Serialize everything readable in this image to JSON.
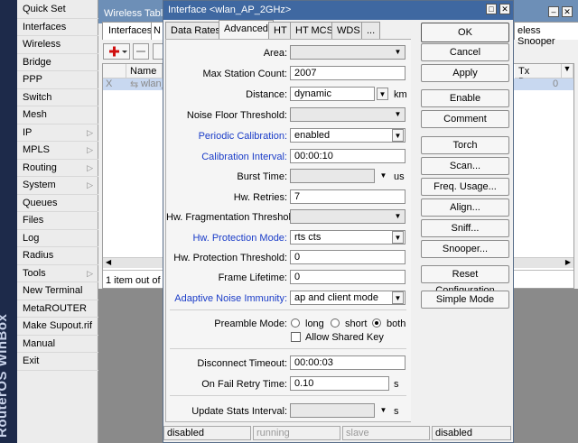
{
  "brand": {
    "text": "RouterOS WinBox"
  },
  "sidebar": {
    "items": [
      {
        "label": "Quick Set",
        "arrow": false
      },
      {
        "label": "Interfaces",
        "arrow": false
      },
      {
        "label": "Wireless",
        "arrow": false
      },
      {
        "label": "Bridge",
        "arrow": false
      },
      {
        "label": "PPP",
        "arrow": false
      },
      {
        "label": "Switch",
        "arrow": false
      },
      {
        "label": "Mesh",
        "arrow": false
      },
      {
        "label": "IP",
        "arrow": true
      },
      {
        "label": "MPLS",
        "arrow": true
      },
      {
        "label": "Routing",
        "arrow": true
      },
      {
        "label": "System",
        "arrow": true
      },
      {
        "label": "Queues",
        "arrow": false
      },
      {
        "label": "Files",
        "arrow": false
      },
      {
        "label": "Log",
        "arrow": false
      },
      {
        "label": "Radius",
        "arrow": false
      },
      {
        "label": "Tools",
        "arrow": true
      },
      {
        "label": "New Terminal",
        "arrow": false
      },
      {
        "label": "MetaROUTER",
        "arrow": false
      },
      {
        "label": "Make Supout.rif",
        "arrow": false
      },
      {
        "label": "Manual",
        "arrow": false
      },
      {
        "label": "Exit",
        "arrow": false
      }
    ],
    "arrow_glyph": "▷"
  },
  "bgwindow": {
    "title": "Wireless Tables",
    "tabs": [
      "Interfaces",
      "N"
    ],
    "right_tab": "eless Snooper",
    "col_name": "Name",
    "col_txdrops": "Tx Drops",
    "row_flag": "X",
    "row_name": "wlan_",
    "row_txdrops": "0",
    "status": "1 item out of 7"
  },
  "dialog": {
    "title": "Interface <wlan_AP_2GHz>",
    "tabs": [
      "Data Rates",
      "Advanced",
      "HT",
      "HT MCS",
      "WDS",
      "..."
    ],
    "active_tab": "Advanced",
    "fields": {
      "area": {
        "label": "Area:",
        "value": ""
      },
      "max_station_count": {
        "label": "Max Station Count:",
        "value": "2007"
      },
      "distance": {
        "label": "Distance:",
        "value": "dynamic",
        "unit": "km"
      },
      "noise_floor": {
        "label": "Noise Floor Threshold:",
        "value": ""
      },
      "periodic_cal": {
        "label": "Periodic Calibration:",
        "value": "enabled"
      },
      "cal_interval": {
        "label": "Calibration Interval:",
        "value": "00:00:10"
      },
      "burst_time": {
        "label": "Burst Time:",
        "value": "",
        "unit": "us"
      },
      "hw_retries": {
        "label": "Hw. Retries:",
        "value": "7"
      },
      "hw_frag": {
        "label": "Hw. Fragmentation Threshold:",
        "value": ""
      },
      "hw_prot_mode": {
        "label": "Hw. Protection Mode:",
        "value": "rts cts"
      },
      "hw_prot_thr": {
        "label": "Hw. Protection Threshold:",
        "value": "0"
      },
      "frame_lifetime": {
        "label": "Frame Lifetime:",
        "value": "0"
      },
      "adaptive_noise": {
        "label": "Adaptive Noise Immunity:",
        "value": "ap and client mode"
      },
      "preamble": {
        "label": "Preamble Mode:",
        "options": [
          "long",
          "short",
          "both"
        ],
        "selected": "both"
      },
      "allow_shared_key": {
        "label": "Allow Shared Key",
        "checked": false
      },
      "disconnect_timeout": {
        "label": "Disconnect Timeout:",
        "value": "00:00:03"
      },
      "on_fail_retry": {
        "label": "On Fail Retry Time:",
        "value": "0.10",
        "unit": "s"
      },
      "update_stats": {
        "label": "Update Stats Interval:",
        "value": "",
        "unit": "s"
      }
    },
    "buttons": [
      "OK",
      "Cancel",
      "Apply",
      "Enable",
      "Comment",
      "Torch",
      "Scan...",
      "Freq. Usage...",
      "Align...",
      "Sniff...",
      "Snooper...",
      "Reset Configuration",
      "Simple Mode"
    ],
    "status": [
      "disabled",
      "running",
      "slave",
      "disabled"
    ]
  }
}
